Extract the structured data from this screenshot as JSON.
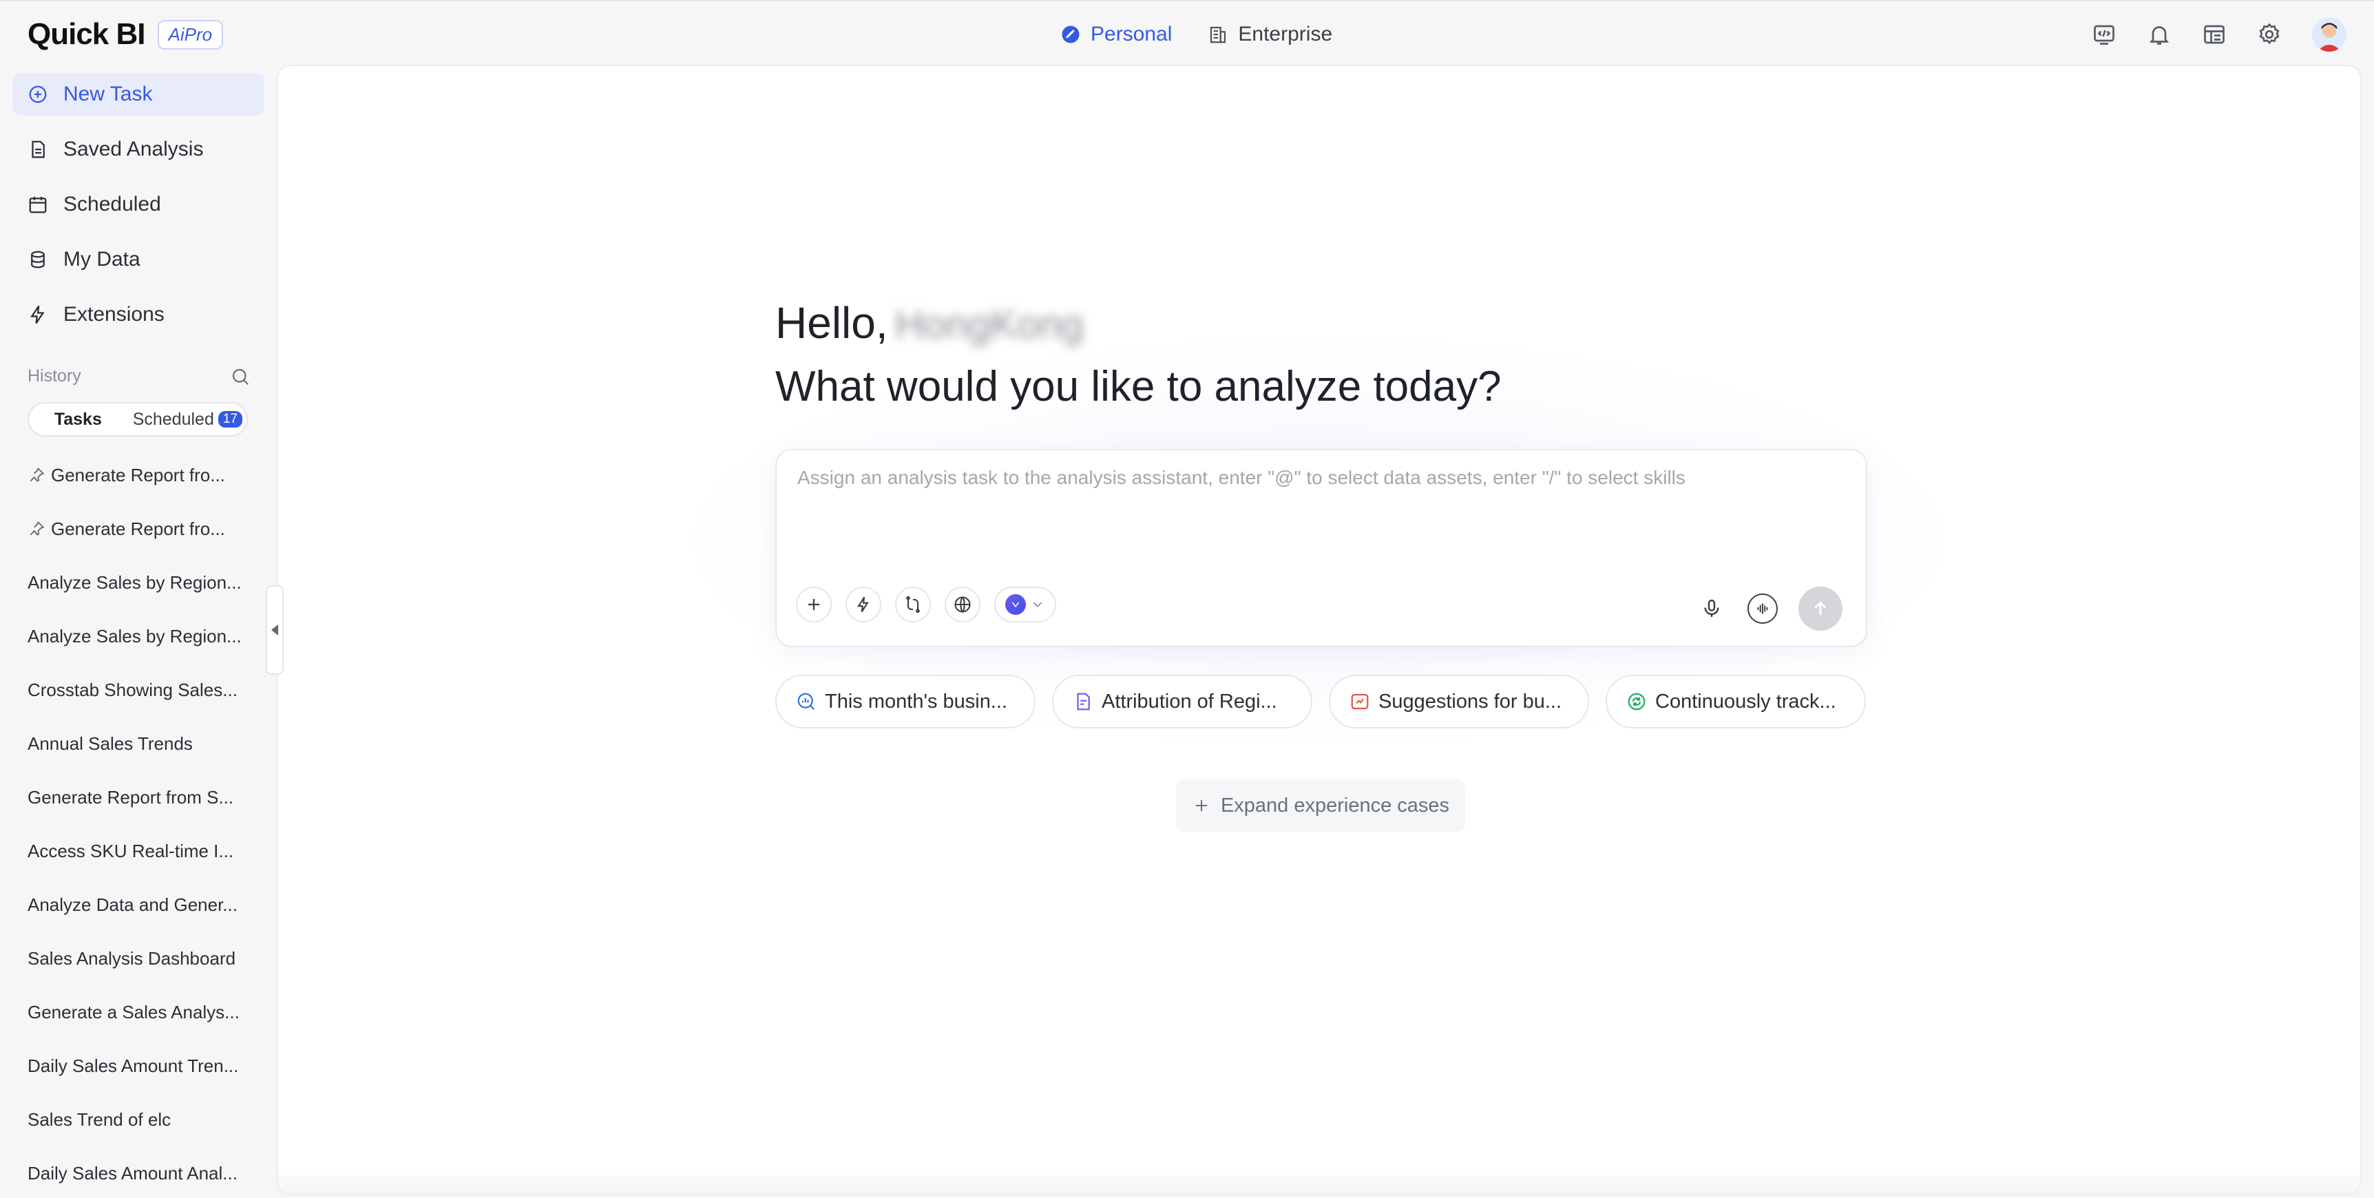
{
  "header": {
    "logo": "Quick BI",
    "badge": "AiPro",
    "modes": [
      {
        "label": "Personal",
        "active": true
      },
      {
        "label": "Enterprise",
        "active": false
      }
    ],
    "icons": [
      "code-icon",
      "bell-icon",
      "dashboard-icon",
      "gear-icon"
    ]
  },
  "sidebar": {
    "nav": [
      {
        "label": "New Task",
        "icon": "plus-circle-icon",
        "active": true
      },
      {
        "label": "Saved Analysis",
        "icon": "document-icon",
        "active": false
      },
      {
        "label": "Scheduled",
        "icon": "calendar-icon",
        "active": false
      },
      {
        "label": "My Data",
        "icon": "database-icon",
        "active": false
      },
      {
        "label": "Extensions",
        "icon": "lightning-icon",
        "active": false
      }
    ],
    "history": {
      "label": "History",
      "tabs": {
        "tasks": "Tasks",
        "scheduled": "Scheduled",
        "scheduled_count": "17"
      },
      "items": [
        {
          "label": "Generate Report fro...",
          "pinned": true
        },
        {
          "label": "Generate Report fro...",
          "pinned": true
        },
        {
          "label": "Analyze Sales by Region..."
        },
        {
          "label": "Analyze Sales by Region..."
        },
        {
          "label": "Crosstab Showing Sales..."
        },
        {
          "label": "Annual Sales Trends"
        },
        {
          "label": "Generate Report from S..."
        },
        {
          "label": "Access SKU Real-time I..."
        },
        {
          "label": "Analyze Data and Gener..."
        },
        {
          "label": "Sales Analysis Dashboard"
        },
        {
          "label": "Generate a Sales Analys..."
        },
        {
          "label": "Daily Sales Amount Tren..."
        },
        {
          "label": "Sales Trend of elc"
        },
        {
          "label": "Daily Sales Amount Anal..."
        }
      ]
    }
  },
  "main": {
    "greeting_prefix": "Hello,",
    "user_name": "HongKong",
    "headline": "What would you like to analyze today?",
    "input": {
      "value": "",
      "placeholder": "Assign an analysis task to the analysis assistant, enter \"@\" to select data assets, enter \"/\" to select skills"
    },
    "suggestions": [
      {
        "label": "This month's busin...",
        "icon": "chat-chart-icon",
        "color": "#3b6fe6"
      },
      {
        "label": "Attribution of Regi...",
        "icon": "report-icon",
        "color": "#7a5cf0"
      },
      {
        "label": "Suggestions for bu...",
        "icon": "insight-icon",
        "color": "#e8553e"
      },
      {
        "label": "Continuously track...",
        "icon": "refresh-icon",
        "color": "#1fae6a"
      }
    ],
    "expand_label": "Expand experience cases"
  },
  "colors": {
    "accent": "#3459e6",
    "active_bg": "#e8ebfa"
  }
}
